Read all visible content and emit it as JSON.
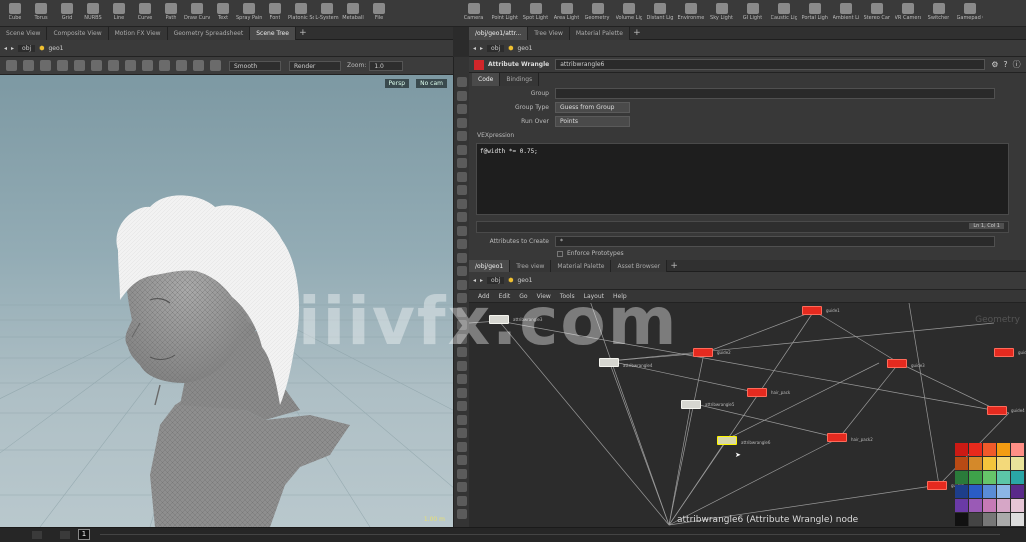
{
  "shelf": {
    "left_tools": [
      "Cube",
      "Torus",
      "Grid",
      "NURBS",
      "Line",
      "Curve",
      "Path",
      "Draw Curve",
      "Text",
      "Spray Paint",
      "Font",
      "Platonic Solids",
      "L-System",
      "Metaball",
      "File"
    ],
    "right_tools": [
      "Camera",
      "Point Light",
      "Spot Light",
      "Area Light",
      "Geometry Light",
      "Volume Light",
      "Distant Light",
      "Environment Light",
      "Sky Light",
      "GI Light",
      "Caustic Light",
      "Portal Light",
      "Ambient Light",
      "Stereo Camera",
      "VR Camera",
      "Switcher",
      "Gamepad Camera"
    ]
  },
  "left_tabs": [
    "Scene View",
    "Composite View",
    "Motion FX View",
    "Geometry Spreadsheet",
    "Scene Tree"
  ],
  "right_tabs": [
    "/obj/geo1/attr...",
    "Tree View",
    "Material Palette"
  ],
  "left_path": {
    "level": "obj",
    "node": "geo1"
  },
  "viewport_toolbar": {
    "shading_mode": "Smooth",
    "display_mode": "Render",
    "zoom_label": "Zoom:",
    "zoom_value": "1.0"
  },
  "viewport": {
    "persp_label": "Persp",
    "camera_label": "No cam",
    "grid_scale": "1.00 m"
  },
  "param_path": {
    "level": "obj",
    "node": "geo1"
  },
  "params": {
    "node_type": "Attribute Wrangle",
    "node_name": "attribwrangle6",
    "tab_code": "Code",
    "tab_bindings": "Bindings",
    "group_label": "Group",
    "group_value": "",
    "group_type_label": "Group Type",
    "group_type_value": "Guess from Group",
    "run_over_label": "Run Over",
    "run_over_value": "Points",
    "vexpression_label": "VEXpression",
    "code_line": "f@width *= 0.75;",
    "line_col": "Ln 1, Col 1",
    "attr_create_label": "Attributes to Create",
    "attr_create_value": "*",
    "enforce_label": "Enforce Prototypes"
  },
  "network_tabs": [
    "/obj/geo1",
    "Tree view",
    "Material Palette",
    "Asset Browser"
  ],
  "network_path": {
    "level": "obj",
    "node": "geo1"
  },
  "network_menu": [
    "Add",
    "Edit",
    "Go",
    "View",
    "Tools",
    "Layout",
    "Help"
  ],
  "network": {
    "context_label": "Geometry",
    "status_text": "attribwrangle6 (Attribute Wrangle) node",
    "nodes": [
      {
        "label": "attribwrangle3",
        "kind": "white"
      },
      {
        "label": "attribwrangle4",
        "kind": "white"
      },
      {
        "label": "attribwrangle5",
        "kind": "white"
      },
      {
        "label": "attribwrangle6",
        "kind": "selected"
      },
      {
        "label": "guide1",
        "kind": "red"
      },
      {
        "label": "guide2",
        "kind": "red"
      },
      {
        "label": "hair_pack",
        "kind": "red"
      },
      {
        "label": "guide3",
        "kind": "red"
      },
      {
        "label": "hair_pack2",
        "kind": "red"
      },
      {
        "label": "guide4",
        "kind": "red"
      },
      {
        "label": "guide5",
        "kind": "red"
      },
      {
        "label": "guide6",
        "kind": "red"
      }
    ],
    "palette_colors": [
      "#cc1a14",
      "#e82a1c",
      "#f05a2a",
      "#f39c12",
      "#ff8f86",
      "#b84a14",
      "#d4892a",
      "#f4c53c",
      "#f3d97a",
      "#e9e39b",
      "#2a7a3a",
      "#3ea24a",
      "#66c66a",
      "#5cc6a8",
      "#2aa6a6",
      "#1e3e8a",
      "#2a5cc6",
      "#5a8cd6",
      "#8cb6e6",
      "#5a2a8a",
      "#6a3aa6",
      "#9a5ab6",
      "#c67ab6",
      "#d6a6c6",
      "#e6c6d6",
      "#111111",
      "#444444",
      "#777777",
      "#aaaaaa",
      "#dddddd"
    ]
  },
  "timeline": {
    "frame": "1"
  },
  "watermark": "iiivfx.com"
}
